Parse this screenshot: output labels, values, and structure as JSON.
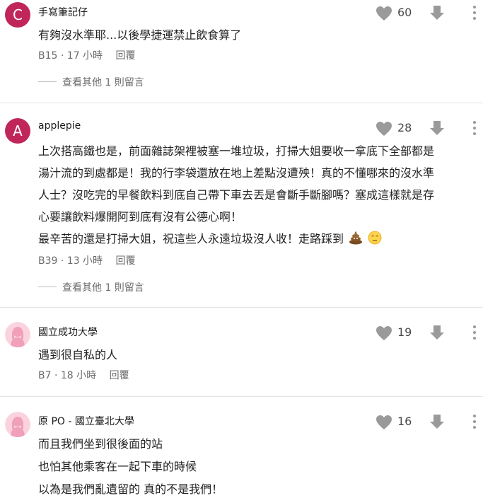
{
  "colors": {
    "avatar_c": "#c0265a",
    "avatar_a": "#c0265a",
    "avatar_female_bg": "#fbd3df",
    "avatar_female_fg": "#f0a0b8",
    "icon_grey": "#9a9a9a"
  },
  "comments": [
    {
      "avatar_letter": "C",
      "author": "手寫筆記仔",
      "likes": "60",
      "lines": [
        "有夠沒水準耶...以後學捷運禁止飲食算了"
      ],
      "floor": "B15",
      "time": "17 小時",
      "reply": "回覆",
      "more_replies": "查看其他 1 則留言"
    },
    {
      "avatar_letter": "A",
      "author": "applepie",
      "likes": "28",
      "lines": [
        "上次搭高鐵也是，前面雜誌架裡被塞一堆垃圾，打掃大姐要收一拿底下全部都是",
        "湯汁流的到處都是！我的行李袋還放在地上差點沒遭殃！真的不懂哪來的沒水準",
        "人士？沒吃完的早餐飲料到底自己帶下車去丟是會斷手斷腳嗎？塞成這樣就是存",
        "心要讓飲料爆開阿到底有沒有公德心啊！",
        "最辛苦的還是打掃大姐，祝這些人永遠垃圾沒人收！走路踩到"
      ],
      "emojis": [
        "poop-emoji",
        "sad-face-emoji"
      ],
      "floor": "B39",
      "time": "13 小時",
      "reply": "回覆",
      "more_replies": "查看其他 1 則留言"
    },
    {
      "author": "國立成功大學",
      "likes": "19",
      "lines": [
        "遇到很自私的人"
      ],
      "floor": "B7",
      "time": "18 小時",
      "reply": "回覆"
    },
    {
      "author": "原 PO - 國立臺北大學",
      "likes": "16",
      "lines": [
        "而且我們坐到很後面的站",
        "也怕其他乘客在一起下車的時候",
        "以為是我們亂遺留的 真的不是我們！"
      ]
    }
  ]
}
